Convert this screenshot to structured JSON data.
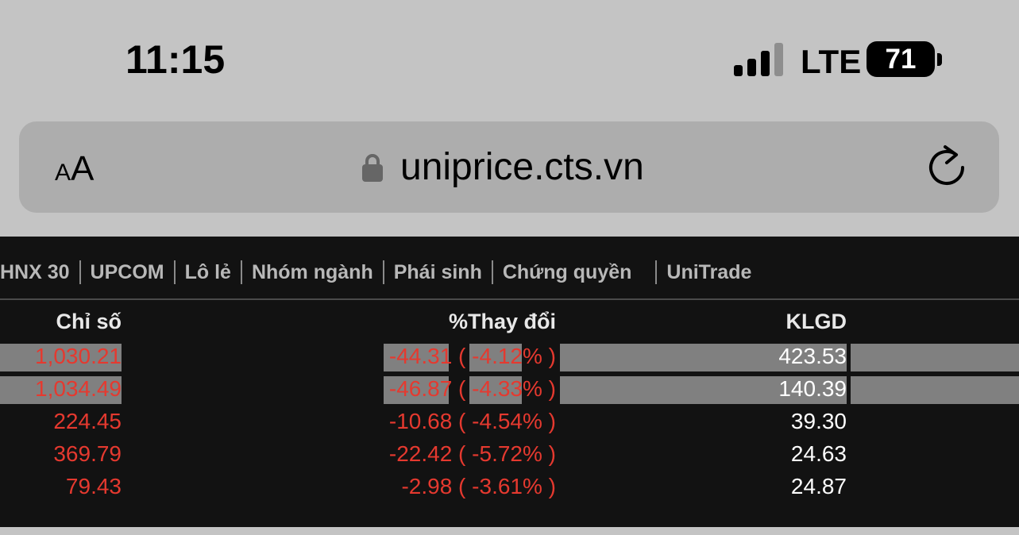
{
  "status_bar": {
    "time": "11:15",
    "network": "LTE",
    "battery": "71"
  },
  "address_bar": {
    "text_size_small": "A",
    "text_size_large": "A",
    "url": "uniprice.cts.vn"
  },
  "tabs": [
    {
      "label": "HNX 30"
    },
    {
      "label": "UPCOM"
    },
    {
      "label": "Lô lẻ"
    },
    {
      "label": "Nhóm ngành"
    },
    {
      "label": "Phái sinh"
    },
    {
      "label": "Chứng quyền"
    },
    {
      "label": "UniTrade"
    }
  ],
  "table": {
    "headers": {
      "index": "Chỉ số",
      "change": "%Thay đổi",
      "volume": "KLGD"
    },
    "rows": [
      {
        "index": "1,030.21",
        "change": "-44.31",
        "pct": "-4.12",
        "volume": "423.53"
      },
      {
        "index": "1,034.49",
        "change": "-46.87",
        "pct": "-4.33",
        "volume": "140.39"
      },
      {
        "index": "224.45",
        "change": "-10.68",
        "pct": "-4.54",
        "volume": "39.30"
      },
      {
        "index": "369.79",
        "change": "-22.42",
        "pct": "-5.72",
        "volume": "24.63"
      },
      {
        "index": "79.43",
        "change": "-2.98",
        "pct": "-3.61",
        "volume": "24.87"
      }
    ]
  },
  "colors": {
    "down": "#e5392f",
    "board_bg": "#121212",
    "highlight": "#808080"
  }
}
